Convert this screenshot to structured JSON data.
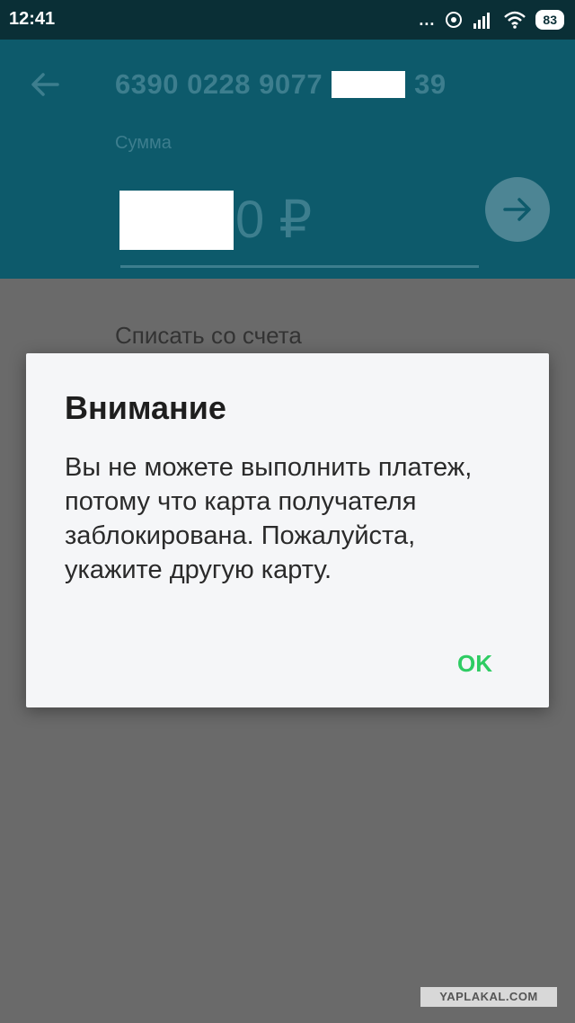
{
  "status_bar": {
    "time": "12:41",
    "dots": "...",
    "battery": "83",
    "icons": [
      "hotspot-icon",
      "signal-icon",
      "wifi-icon",
      "battery-icon"
    ]
  },
  "header": {
    "back_icon": "arrow-left-icon",
    "card_number_start": "6390 0228 9077",
    "card_number_end": "39",
    "sum_label": "Сумма",
    "amount_suffix": "0 ₽",
    "next_icon": "arrow-right-icon"
  },
  "background": {
    "debit_label": "Списать со счета"
  },
  "dialog": {
    "title": "Внимание",
    "message": "Вы не можете выполнить платеж, потому что карта получателя заблокирована. Пожалуйста, укажите другую карту.",
    "ok_label": "OK"
  },
  "watermark": "YAPLAKAL.COM",
  "colors": {
    "statusbar_bg": "#0a2f36",
    "appbar_bg": "#0d5a6b",
    "dim_text": "#3d7e8e",
    "ok_accent": "#2ecc63",
    "dialog_bg": "#f5f6f8",
    "overlay": "#6a6a6a"
  }
}
